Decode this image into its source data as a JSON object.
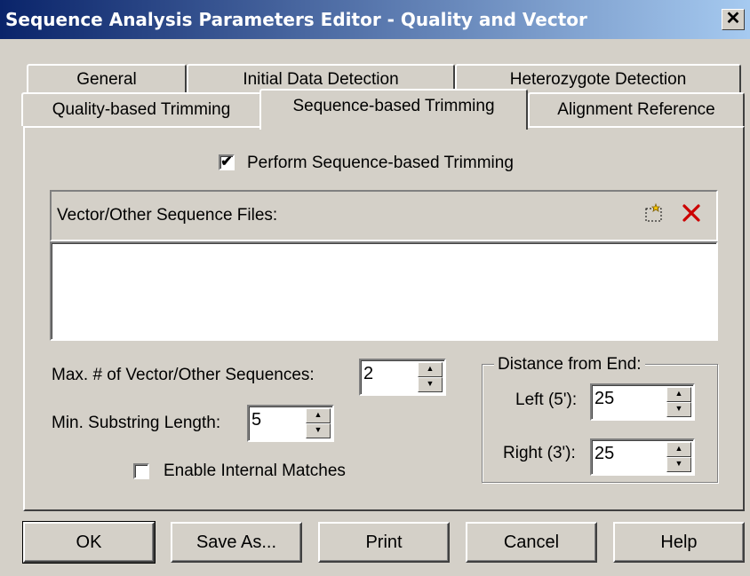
{
  "window": {
    "title": "Sequence Analysis Parameters Editor - Quality and Vector",
    "close_glyph": "✕"
  },
  "tabs": {
    "row1": [
      "General",
      "Initial Data Detection",
      "Heterozygote Detection"
    ],
    "row2": [
      "Quality-based Trimming",
      "Sequence-based Trimming",
      "Alignment Reference"
    ],
    "active": "Sequence-based Trimming"
  },
  "perform": {
    "label": "Perform Sequence-based Trimming",
    "checked": true,
    "mark": "✔"
  },
  "vector_files": {
    "label": "Vector/Other Sequence Files:",
    "add_icon": "new-file-icon",
    "delete_icon": "delete-x-icon",
    "items": []
  },
  "max_vector": {
    "label": "Max. # of Vector/Other Sequences:",
    "value": "2"
  },
  "min_substring": {
    "label": "Min. Substring Length:",
    "value": "5"
  },
  "internal_matches": {
    "label": "Enable Internal Matches",
    "checked": false
  },
  "distance": {
    "title": "Distance from End:",
    "left_label": "Left (5'):",
    "left_value": "25",
    "right_label": "Right (3'):",
    "right_value": "25"
  },
  "buttons": {
    "ok": "OK",
    "save_as": "Save As...",
    "print": "Print",
    "cancel": "Cancel",
    "help": "Help"
  },
  "colors": {
    "titlebar_start": "#0a246a",
    "titlebar_end": "#a6caf0",
    "face": "#d4d0c8",
    "delete_red": "#cc0000"
  }
}
